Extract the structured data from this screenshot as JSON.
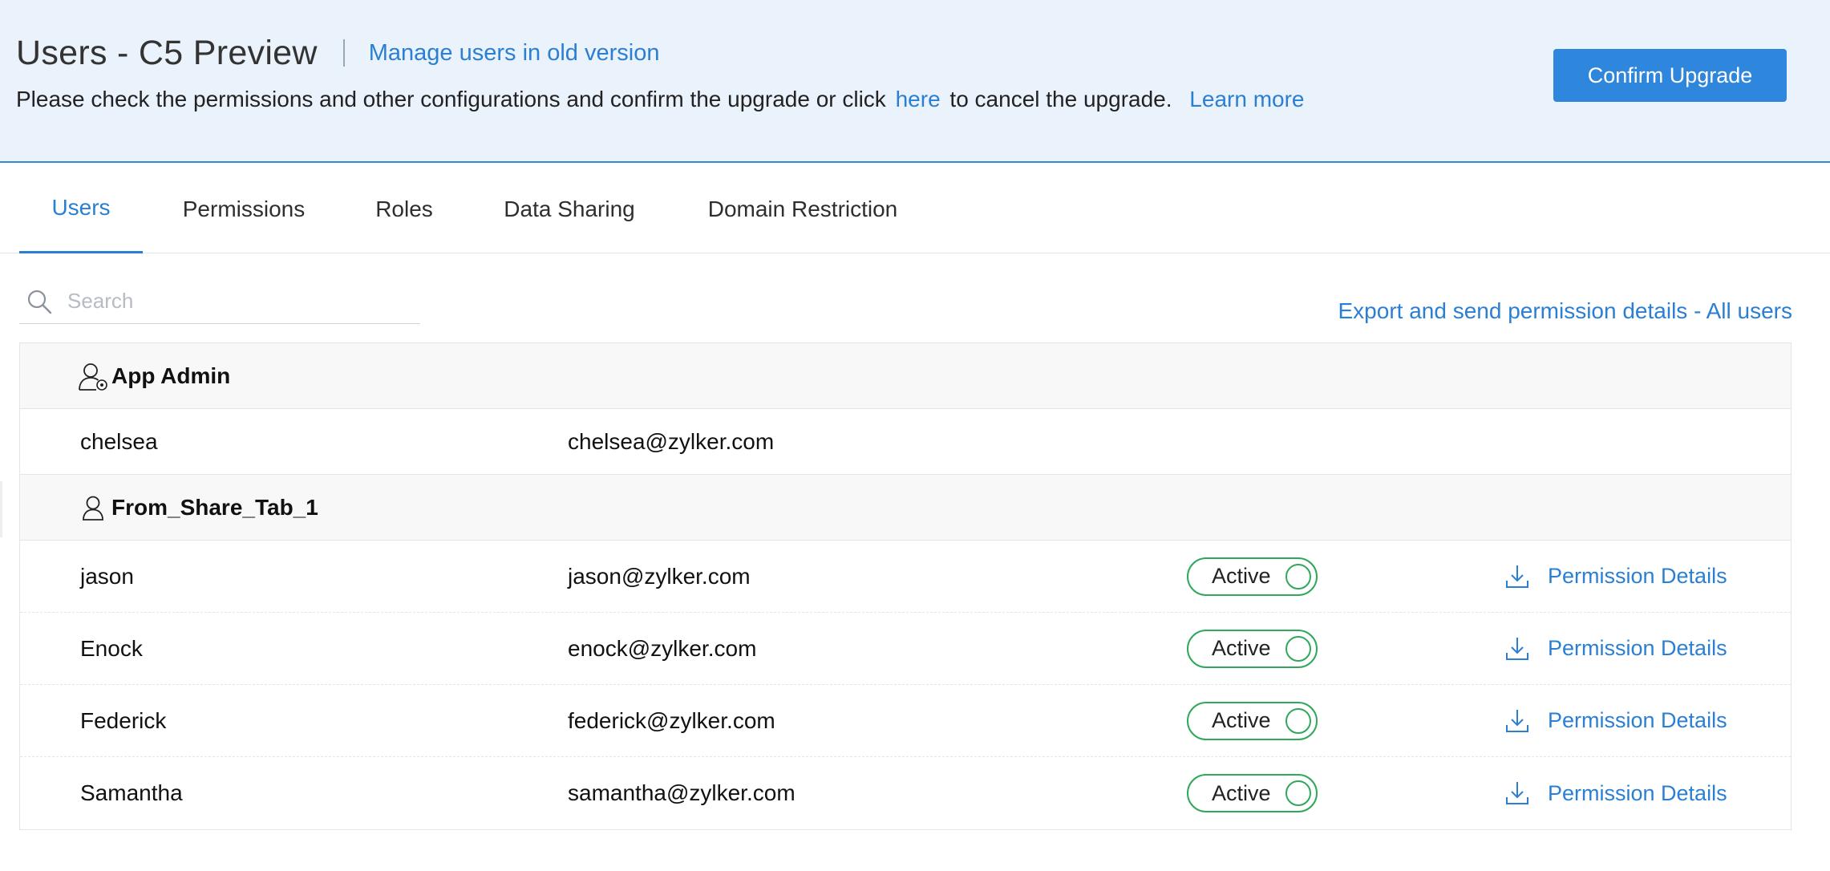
{
  "banner": {
    "title": "Users - C5 Preview",
    "old_version_link": "Manage users in old version",
    "description_before": "Please check the permissions and other configurations and confirm the upgrade or click",
    "here_link": "here",
    "description_after": "to cancel the upgrade.",
    "learn_more": "Learn more",
    "confirm_button": "Confirm Upgrade",
    "accent_color": "#2b7fd3",
    "background_color": "#eaf2fb"
  },
  "tabs": [
    {
      "label": "Users",
      "active": true
    },
    {
      "label": "Permissions",
      "active": false
    },
    {
      "label": "Roles",
      "active": false
    },
    {
      "label": "Data Sharing",
      "active": false
    },
    {
      "label": "Domain Restriction",
      "active": false
    }
  ],
  "search": {
    "placeholder": "Search",
    "value": "",
    "icon": "search-icon"
  },
  "export_link": "Export and send permission details - All users",
  "groups": [
    {
      "name": "App Admin",
      "icon": "admin-user-icon",
      "users": [
        {
          "name": "chelsea",
          "email": "chelsea@zylker.com"
        }
      ]
    },
    {
      "name": "From_Share_Tab_1",
      "icon": "user-icon",
      "users": [
        {
          "name": "jason",
          "email": "jason@zylker.com",
          "status": "Active",
          "action": "Permission Details"
        },
        {
          "name": "Enock",
          "email": "enock@zylker.com",
          "status": "Active",
          "action": "Permission Details"
        },
        {
          "name": "Federick",
          "email": "federick@zylker.com",
          "status": "Active",
          "action": "Permission Details"
        },
        {
          "name": "Samantha",
          "email": "samantha@zylker.com",
          "status": "Active",
          "action": "Permission Details"
        }
      ]
    }
  ],
  "status_color": "#2fa85a"
}
